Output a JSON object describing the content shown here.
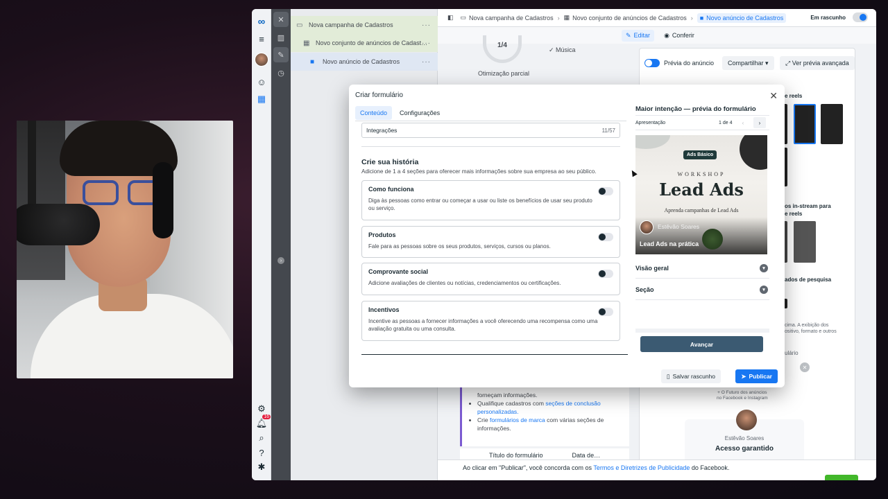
{
  "tree": {
    "campaign": "Nova campanha de Cadastros",
    "adset": "Novo conjunto de anúncios de Cadast…",
    "ad": "Novo anúncio de Cadastros",
    "dots": "···"
  },
  "topbar": {
    "crumb1": "Nova campanha de Cadastros",
    "crumb2": "Novo conjunto de anúncios de Cadastros",
    "crumb3": "Novo anúncio de Cadastros",
    "draft": "Em rascunho",
    "edit": "Editar",
    "review": "Conferir"
  },
  "background": {
    "optim_value": "1/4",
    "optim_label": "Otimização parcial",
    "musica": "Música",
    "preview_toggle": "Prévia do anúncio",
    "share": "Compartilhar",
    "advanced": "Ver prévia avançada",
    "reels": "e reels",
    "instream": "os in-stream para\ne reels",
    "search": "ados de pesquisa",
    "note": "cima. A exibição dos\nositivo, formato e outros",
    "rio": "ulário",
    "bullet0": "forneçam informações.",
    "bullet1_pre": "Qualifique cadastros com ",
    "bullet1_link": "seções de conclusão personalizadas.",
    "bullet2_pre": "Crie ",
    "bullet2_link": "formulários de marca",
    "bullet2_post": " com várias seções de informações.",
    "col1": "Título do formulário",
    "col2": "Data de…",
    "footer_pre": "Ao clicar em \"Publicar\", você concorda com os ",
    "footer_link": "Termos e Diretrizes de Publicidade",
    "footer_post": " do Facebook.",
    "sample_small": "+ O Futuro dos anúncios\nno Facebook e Instagram",
    "sample_name": "Estêvão Soares",
    "sample_acesso": "Acesso garantido",
    "notif_count": "16"
  },
  "modal": {
    "title": "Criar formulário",
    "tabs": [
      "Conteúdo",
      "Configurações"
    ],
    "integrations": {
      "label": "Integrações",
      "count": "11/57"
    },
    "story": {
      "title": "Crie sua história",
      "subtitle": "Adicione de 1 a 4 seções para oferecer mais informações sobre sua empresa ao seu público."
    },
    "cards": [
      {
        "title": "Como funciona",
        "desc": "Diga às pessoas como entrar ou começar a usar ou liste os benefícios de usar seu produto ou serviço."
      },
      {
        "title": "Produtos",
        "desc": "Fale para as pessoas sobre os seus produtos, serviços, cursos ou planos."
      },
      {
        "title": "Comprovante social",
        "desc": "Adicione avaliações de clientes ou notícias, credenciamentos ou certificações."
      },
      {
        "title": "Incentivos",
        "desc": "Incentive as pessoas a fornecer informações a você oferecendo uma recompensa como uma avaliação gratuita ou uma consulta."
      }
    ],
    "preview": {
      "title": "Maior intenção — prévia do formulário",
      "section": "Apresentação",
      "page": "1 de 4",
      "badge": "Ads Básico",
      "workshop": "WORKSHOP",
      "headline": "Lead Ads",
      "learn": "Aprenda campanhas de Lead Ads",
      "name": "Estêvão Soares",
      "caption": "Lead Ads na prática",
      "acc1": "Visão geral",
      "acc2": "Seção",
      "advance": "Avançar"
    },
    "save_draft": "Salvar rascunho",
    "publish": "Publicar"
  }
}
